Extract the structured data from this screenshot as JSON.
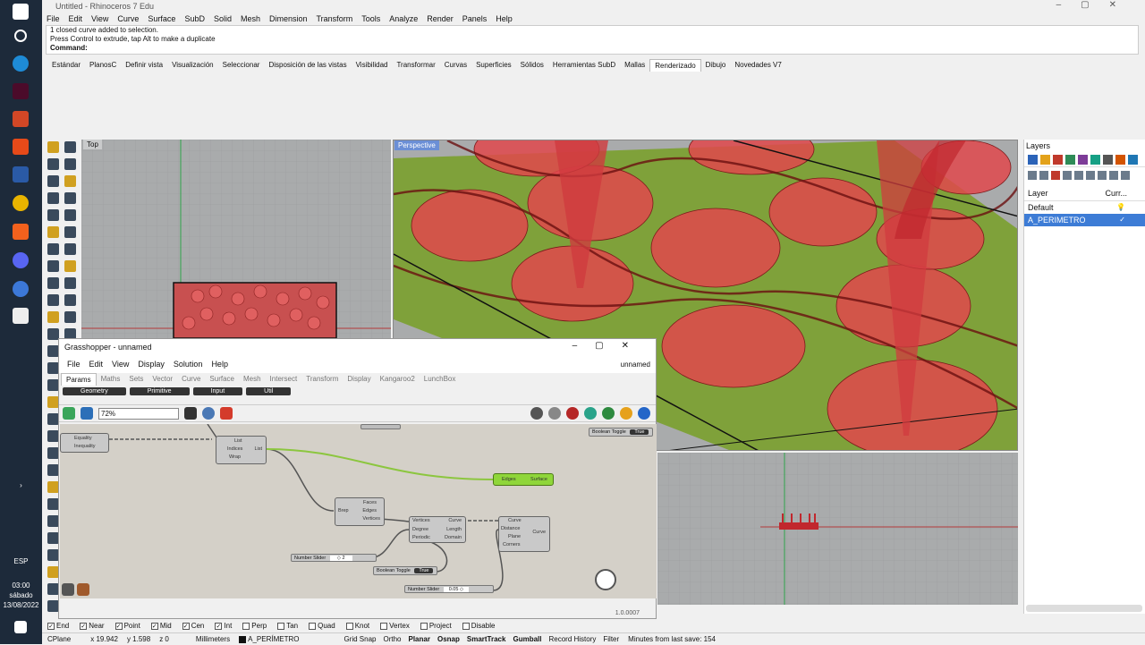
{
  "taskbar": {
    "lang": "ESP",
    "time": "03:00",
    "day": "sábado",
    "date": "13/08/2022"
  },
  "rhino": {
    "title": "Untitled - Rhinoceros 7 Edu",
    "menu": [
      "File",
      "Edit",
      "View",
      "Curve",
      "Surface",
      "SubD",
      "Solid",
      "Mesh",
      "Dimension",
      "Transform",
      "Tools",
      "Analyze",
      "Render",
      "Panels",
      "Help"
    ],
    "history": [
      "1 closed curve added to selection.",
      "Press Control to extrude, tap Alt to make a duplicate"
    ],
    "command_label": "Command:",
    "tabs": [
      "Estándar",
      "PlanosC",
      "Definir vista",
      "Visualización",
      "Seleccionar",
      "Disposición de las vistas",
      "Visibilidad",
      "Transformar",
      "Curvas",
      "Superficies",
      "Sólidos",
      "Herramientas SubD",
      "Mallas",
      "Renderizado",
      "Dibujo",
      "Novedades V7"
    ],
    "active_tab": "Renderizado"
  },
  "viewports": {
    "top_label": "Top",
    "perspective_label": "Perspective"
  },
  "grasshopper": {
    "title": "Grasshopper - unnamed",
    "menu": [
      "File",
      "Edit",
      "View",
      "Display",
      "Solution",
      "Help"
    ],
    "doc_name": "unnamed",
    "tabs": [
      "Params",
      "Maths",
      "Sets",
      "Vector",
      "Curve",
      "Surface",
      "Mesh",
      "Intersect",
      "Transform",
      "Display",
      "Kangaroo2",
      "LunchBox"
    ],
    "active_tab": "Params",
    "groups": [
      "Geometry",
      "Primitive",
      "Input",
      "Util"
    ],
    "zoom": "72%",
    "version": "1.0.0007",
    "components": {
      "equality": {
        "in": "",
        "outs": [
          "Equality",
          "Inequality"
        ]
      },
      "list": {
        "ins": [
          "List",
          "Indices",
          "Wrap"
        ],
        "out": "List"
      },
      "brep": {
        "in": "Brep",
        "outs": [
          "Faces",
          "Edges",
          "Vertices"
        ]
      },
      "edges": {
        "in": "Edges",
        "out": "Surface"
      },
      "curve_len": {
        "ins": [
          "Vertices",
          "Degree",
          "Periodic"
        ],
        "outs": [
          "Curve",
          "Length",
          "Domain"
        ]
      },
      "offset": {
        "ins": [
          "Curve",
          "Distance",
          "Plane",
          "Corners"
        ],
        "out": "Curve"
      },
      "num_slider_1": {
        "label": "Number Slider",
        "value": "◇ 2"
      },
      "bool_toggle_1": {
        "label": "Boolean Toggle",
        "value": "True"
      },
      "num_slider_2": {
        "label": "Number Slider",
        "value": "0.05 ◇"
      },
      "bool_toggle_top": {
        "label": "Boolean Toggle",
        "value": "True"
      }
    }
  },
  "layers": {
    "title": "Layers",
    "col_layer": "Layer",
    "col_current": "Curr...",
    "rows": [
      {
        "name": "Default",
        "selected": false
      },
      {
        "name": "A_PERIMETRO",
        "selected": true
      }
    ]
  },
  "osnap": {
    "items": [
      {
        "label": "End",
        "checked": true
      },
      {
        "label": "Near",
        "checked": true
      },
      {
        "label": "Point",
        "checked": true
      },
      {
        "label": "Mid",
        "checked": true
      },
      {
        "label": "Cen",
        "checked": true
      },
      {
        "label": "Int",
        "checked": true
      },
      {
        "label": "Perp",
        "checked": false
      },
      {
        "label": "Tan",
        "checked": false
      },
      {
        "label": "Quad",
        "checked": false
      },
      {
        "label": "Knot",
        "checked": false
      },
      {
        "label": "Vertex",
        "checked": false
      },
      {
        "label": "Project",
        "checked": false
      },
      {
        "label": "Disable",
        "checked": false
      }
    ]
  },
  "status": {
    "cplane": "CPlane",
    "x": "x 19.942",
    "y": "y 1.598",
    "z": "z 0",
    "units": "Millimeters",
    "layer": "A_PERÍMETRO",
    "toggles": [
      "Grid Snap",
      "Ortho",
      "Planar",
      "Osnap",
      "SmartTrack",
      "Gumball",
      "Record History",
      "Filter"
    ],
    "save_info": "Minutes from last save: 154"
  },
  "colors": {
    "accent_red": "#c8262a",
    "green": "#7fb32a",
    "gh_canvas": "#d4d0c8",
    "selected_layer": "#3d7cd6"
  }
}
